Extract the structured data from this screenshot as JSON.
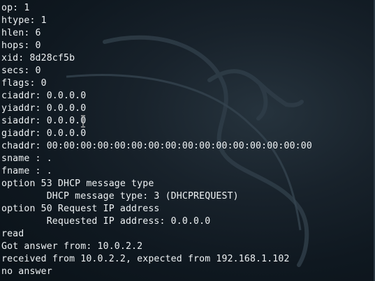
{
  "terminal": {
    "lines": [
      "op: 1",
      "htype: 1",
      "hlen: 6",
      "hops: 0",
      "xid: 8d28cf5b",
      "secs: 0",
      "flags: 0",
      "ciaddr: 0.0.0.0",
      "yiaddr: 0.0.0.0",
      "siaddr: 0.0.0.0",
      "giaddr: 0.0.0.0",
      "chaddr: 00:00:00:00:00:00:00:00:00:00:00:00:00:00:00:00",
      "sname : .",
      "fname : .",
      "option 53 DHCP message type",
      "        DHCP message type: 3 (DHCPREQUEST)",
      "option 50 Request IP address",
      "        Requested IP address: 0.0.0.0",
      "read",
      "Got answer from: 10.0.2.2",
      "received from 10.0.2.2, expected from 192.168.1.102",
      "no answer"
    ]
  },
  "colors": {
    "text": "#eef2f4",
    "background": "#0b141c"
  },
  "icons": {
    "background_logo": "kali-dragon-icon",
    "pointer": "text-cursor-icon"
  }
}
